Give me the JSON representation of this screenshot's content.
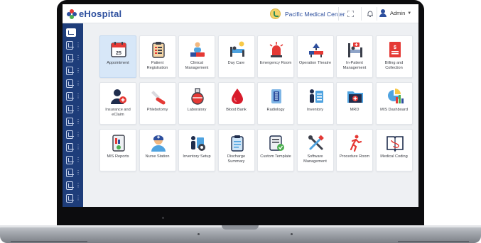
{
  "app": {
    "logo_text": "eHospital",
    "center_name": "Pacific Medical Center",
    "user_name": "Admin"
  },
  "icons": {
    "logo": "ehospital-logo",
    "center": "smiley-center-icon",
    "fullscreen": "fullscreen-icon",
    "notifications": "bell-icon",
    "user": "user-icon",
    "caret": "caret-down-icon"
  },
  "sidebar": {
    "items": [
      {
        "icon": "dashboard-icon",
        "active": true
      },
      {
        "icon": "calendar-icon",
        "active": false
      },
      {
        "icon": "patient-icon",
        "active": false
      },
      {
        "icon": "bed-icon",
        "active": false
      },
      {
        "icon": "records-icon",
        "active": false
      },
      {
        "icon": "list-icon",
        "active": false
      },
      {
        "icon": "injection-icon",
        "active": false
      },
      {
        "icon": "lab-icon",
        "active": false
      },
      {
        "icon": "billing-icon",
        "active": false
      },
      {
        "icon": "report-icon",
        "active": false
      },
      {
        "icon": "tools-icon",
        "active": false
      },
      {
        "icon": "test-tube-icon",
        "active": false
      },
      {
        "icon": "drop-icon",
        "active": false
      },
      {
        "icon": "user-settings-icon",
        "active": false
      }
    ]
  },
  "modules": [
    {
      "label": "Appointment",
      "icon": "calendar-25-icon",
      "badge": "25",
      "selected": true
    },
    {
      "label": "Patient Registration",
      "icon": "clipboard-icon",
      "selected": false
    },
    {
      "label": "Clinical Management",
      "icon": "clinical-team-icon",
      "selected": false
    },
    {
      "label": "Day Care",
      "icon": "day-bed-icon",
      "selected": false
    },
    {
      "label": "Emergency Room",
      "icon": "siren-icon",
      "selected": false
    },
    {
      "label": "Operation Theatre",
      "icon": "operation-lamp-icon",
      "selected": false
    },
    {
      "label": "In-Patient Management",
      "icon": "hospital-bed-icon",
      "selected": false
    },
    {
      "label": "Billing and Collection",
      "icon": "invoice-icon",
      "selected": false
    },
    {
      "label": "Insurance and eClaim",
      "icon": "insurance-user-icon",
      "selected": false
    },
    {
      "label": "Phlebotomy",
      "icon": "blood-sample-icon",
      "selected": false
    },
    {
      "label": "Laboratory",
      "icon": "flask-icon",
      "selected": false
    },
    {
      "label": "Blood Bank",
      "icon": "blood-drop-icon",
      "selected": false
    },
    {
      "label": "Radiology",
      "icon": "xray-icon",
      "selected": false
    },
    {
      "label": "Inventory",
      "icon": "inventory-clipboard-icon",
      "selected": false
    },
    {
      "label": "MRD",
      "icon": "medical-folder-icon",
      "selected": false
    },
    {
      "label": "MIS Dashboard",
      "icon": "pie-bar-chart-icon",
      "selected": false
    },
    {
      "label": "MIS Reports",
      "icon": "report-chart-icon",
      "selected": false
    },
    {
      "label": "Nurse Station",
      "icon": "nurse-icon",
      "selected": false
    },
    {
      "label": "Inventory Setup",
      "icon": "inventory-gear-icon",
      "selected": false
    },
    {
      "label": "Discharge Summary",
      "icon": "discharge-clipboard-icon",
      "selected": false
    },
    {
      "label": "Custom Template",
      "icon": "template-check-icon",
      "selected": false
    },
    {
      "label": "Software Management",
      "icon": "wrench-screwdriver-icon",
      "selected": false
    },
    {
      "label": "Procedure Room",
      "icon": "running-person-icon",
      "selected": false
    },
    {
      "label": "Medical Coding",
      "icon": "medical-book-icon",
      "selected": false
    }
  ],
  "colors": {
    "brand_blue": "#2d4f9e",
    "sidebar": "#1e3d7a",
    "selected_tile": "#d7e7f8",
    "accent_red": "#e53935"
  }
}
